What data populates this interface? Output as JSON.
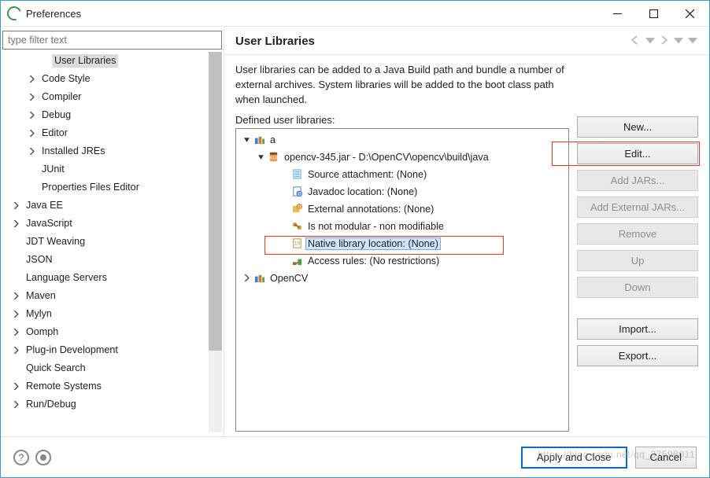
{
  "window": {
    "title": "Preferences"
  },
  "filter": {
    "placeholder": "type filter text"
  },
  "leftTree": {
    "selected": "User Libraries",
    "nodes": [
      {
        "level": 2,
        "arrow": false,
        "label": "User Libraries",
        "sel": true
      },
      {
        "level": 1,
        "arrow": true,
        "label": "Code Style"
      },
      {
        "level": 1,
        "arrow": true,
        "label": "Compiler"
      },
      {
        "level": 1,
        "arrow": true,
        "label": "Debug"
      },
      {
        "level": 1,
        "arrow": true,
        "label": "Editor"
      },
      {
        "level": 1,
        "arrow": true,
        "label": "Installed JREs"
      },
      {
        "level": 1,
        "arrow": false,
        "label": "JUnit"
      },
      {
        "level": 1,
        "arrow": false,
        "label": "Properties Files Editor"
      },
      {
        "level": 0,
        "arrow": true,
        "label": "Java EE"
      },
      {
        "level": 0,
        "arrow": true,
        "label": "JavaScript"
      },
      {
        "level": 0,
        "arrow": false,
        "label": "JDT Weaving"
      },
      {
        "level": 0,
        "arrow": false,
        "label": "JSON"
      },
      {
        "level": 0,
        "arrow": false,
        "label": "Language Servers"
      },
      {
        "level": 0,
        "arrow": true,
        "label": "Maven"
      },
      {
        "level": 0,
        "arrow": true,
        "label": "Mylyn"
      },
      {
        "level": 0,
        "arrow": true,
        "label": "Oomph"
      },
      {
        "level": 0,
        "arrow": true,
        "label": "Plug-in Development"
      },
      {
        "level": 0,
        "arrow": false,
        "label": "Quick Search"
      },
      {
        "level": 0,
        "arrow": true,
        "label": "Remote Systems"
      },
      {
        "level": 0,
        "arrow": true,
        "label": "Run/Debug"
      }
    ]
  },
  "rightPanel": {
    "heading": "User Libraries",
    "description": "User libraries can be added to a Java Build path and bundle a number of external archives. System libraries will be added to the boot class path when launched.",
    "definedLabel": "Defined user libraries:"
  },
  "libTree": [
    {
      "l": 1,
      "exp": true,
      "arrow": true,
      "icon": "lib",
      "text": "a"
    },
    {
      "l": 2,
      "exp": true,
      "arrow": true,
      "icon": "jar",
      "text": "opencv-345.jar - D:\\OpenCV\\opencv\\build\\java"
    },
    {
      "l": 3,
      "arrow": false,
      "icon": "src",
      "text": "Source attachment: (None)"
    },
    {
      "l": 3,
      "arrow": false,
      "icon": "doc",
      "text": "Javadoc location: (None)"
    },
    {
      "l": 3,
      "arrow": false,
      "icon": "ann",
      "text": "External annotations: (None)"
    },
    {
      "l": 3,
      "arrow": false,
      "icon": "mod",
      "text": "Is not modular - non modifiable"
    },
    {
      "l": 3,
      "arrow": false,
      "icon": "nat",
      "text": "Native library location: (None)",
      "sel": true
    },
    {
      "l": 3,
      "arrow": false,
      "icon": "acc",
      "text": "Access rules: (No restrictions)"
    },
    {
      "l": 1,
      "arrow": true,
      "icon": "lib",
      "text": "OpenCV"
    }
  ],
  "buttons": {
    "newBtn": "New...",
    "editBtn": "Edit...",
    "addJars": "Add JARs...",
    "addExt": "Add External JARs...",
    "remove": "Remove",
    "up": "Up",
    "down": "Down",
    "importBtn": "Import...",
    "exportBtn": "Export..."
  },
  "footer": {
    "apply": "Apply and Close",
    "cancel": "Cancel"
  },
  "watermark": "https://blog.csdn.net/qq_37598011"
}
